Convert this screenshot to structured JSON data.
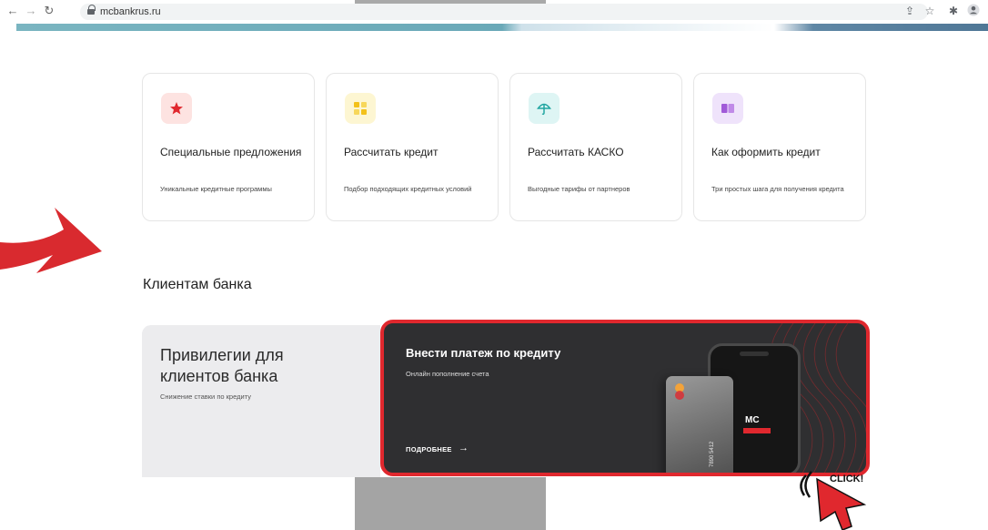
{
  "browser": {
    "url": "mcbankrus.ru",
    "nav_icons": [
      "back-icon",
      "forward-icon",
      "reload-icon"
    ],
    "toolbar_icons": [
      "share-icon",
      "star-icon",
      "extensions-icon",
      "profile-icon"
    ]
  },
  "cards": [
    {
      "icon": "star-icon",
      "icon_bg": "#fde3e1",
      "icon_color": "#e0282e",
      "title": "Специальные предложения",
      "subtitle": "Уникальные кредитные программы"
    },
    {
      "icon": "calculator-icon",
      "icon_bg": "#fdf6d2",
      "icon_color": "#f3c11a",
      "title": "Рассчитать кредит",
      "subtitle": "Подбор подходящих кредитных условий"
    },
    {
      "icon": "umbrella-icon",
      "icon_bg": "#def5f4",
      "icon_color": "#22a6a1",
      "title": "Рассчитать КАСКО",
      "subtitle": "Выгодные тарифы от партнеров"
    },
    {
      "icon": "book-icon",
      "icon_bg": "#efe3fb",
      "icon_color": "#a05ad8",
      "title": "Как оформить кредит",
      "subtitle": "Три простых шага для получения кредита"
    }
  ],
  "section": {
    "title": "Клиентам банка"
  },
  "privileges": {
    "title": "Привилегии для клиентов банка",
    "subtitle": "Снижение ставки по кредиту"
  },
  "payment": {
    "title": "Внести платеж по кредиту",
    "subtitle": "Онлайн пополнение счета",
    "more_label": "ПОДРОБНЕЕ",
    "phone_label": "MC",
    "card_number": "7890 5412",
    "highlight_color": "#e0282e"
  },
  "annotation": {
    "click_label": "CLICK!"
  },
  "colors": {
    "accent": "#e0282e",
    "dark_card": "#2f2f31"
  }
}
